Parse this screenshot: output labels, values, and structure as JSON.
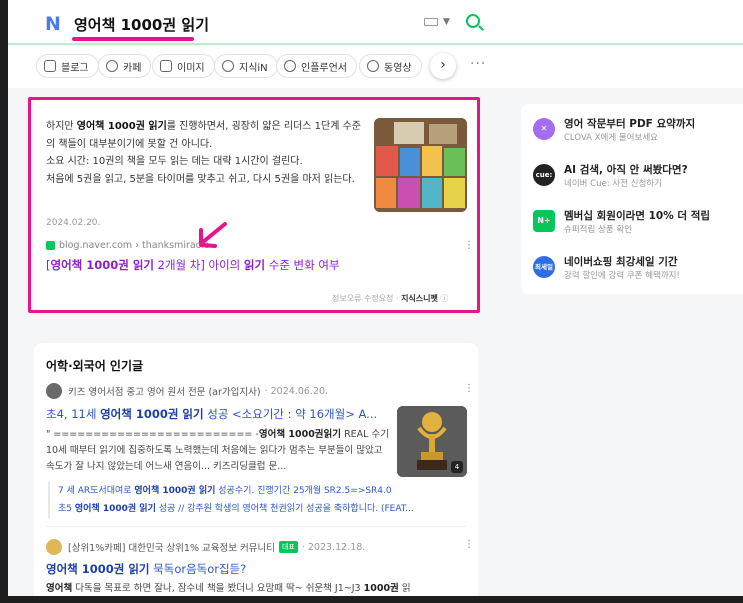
{
  "header": {
    "logo": "N",
    "query": "영어책 1000권 읽기"
  },
  "tabs": [
    {
      "label": "블로그",
      "icon": "blog-icon"
    },
    {
      "label": "카페",
      "icon": "cafe-icon"
    },
    {
      "label": "이미지",
      "icon": "image-icon"
    },
    {
      "label": "지식iN",
      "icon": "kin-icon"
    },
    {
      "label": "인플루언서",
      "icon": "influencer-icon"
    },
    {
      "label": "동영상",
      "icon": "video-icon"
    }
  ],
  "snippet": {
    "pre": "하지만 ",
    "bold1": "영어책 1000권 읽기",
    "post": "를 진행하면서, 굉장히 얇은 리더스 1단계 수준의 책들이 대부분이기에 못할 건 아니다.",
    "line2": "소요 시간: 10권의 책을 모두 읽는 데는 대략 1시간이 걸린다.",
    "line3": "처음에 5권을 읽고, 5분을 타이머를 맞추고 쉬고, 다시 5권을 마저 읽는다.",
    "date": "2024.02.20.",
    "source": "blog.naver.com › thanksmiracle",
    "link_prefix": "[",
    "link_bold": "영어책 1000권 읽기",
    "link_mid": " 2개월 차] 아이의 ",
    "link_bold2": "읽기",
    "link_suffix": " 수준 변화 여부",
    "footer_report": "정보오류 수정요청 · ",
    "footer_brand": "지식스니펫"
  },
  "side": [
    {
      "title": "영어 작문부터 PDF 요약까지",
      "sub": "CLOVA X에게 물어보세요",
      "icon": "clova-x-icon",
      "color": "#a66cf0",
      "mark": "✕"
    },
    {
      "title": "AI 검색, 아직 안 써봤다면?",
      "sub": "네이버 Cue: 사전 신청하기",
      "icon": "cue-icon",
      "color": "#222222",
      "mark": "cue:"
    },
    {
      "title": "멤버십 회원이라면 10% 더 적립",
      "sub": "슈퍼적립 상품 확인",
      "icon": "npay-icon",
      "color": "#03c75a",
      "mark": "N+"
    },
    {
      "title": "네이버쇼핑 최강세일 기간",
      "sub": "강력 할인에 강력 쿠폰 혜택까지!",
      "icon": "shopping-icon",
      "color": "#2f6de8",
      "mark": "최세일"
    }
  ],
  "popular": {
    "heading": "어학·외국어 인기글",
    "post1": {
      "author": "키즈 영어서점 중고 영어 원서 전문 (ar가입지사)",
      "date": "· 2024.06.20.",
      "title_pre": "초4, 11세 ",
      "title_bold": "영어책 1000권 읽기",
      "title_post": " 성공 <소요기간 : 약 16개월> A...",
      "body_pre": "\" ========================= -",
      "body_bold": "영어책 1000권읽기",
      "body_post": " REAL 수기 10세 때부터 읽기에 집중하도록 노력했는데 처음에는 읽다가 멈추는 부분들이 많았고 속도가 잘 나지 않았는데 어느새 연음이... 키즈리딩클럽 문...",
      "image_count": "4",
      "sub1_pre": "7 세 AR도서대여로 ",
      "sub1_bold": "영어책 1000권 읽기",
      "sub1_post": " 성공수기. 진행기간 25개월 SR2.5=>SR4.0",
      "sub2_pre": "초5 ",
      "sub2_bold": "영어책 1000권 읽기",
      "sub2_post": " 성공 // 강주원 학생의 영어책 천권읽기 성공을 축하합니다. (FEAT..."
    },
    "post2": {
      "author": "[상위1%카페] 대한민국 상위1% 교육정보 커뮤니티",
      "badge": "대표",
      "date": "· 2023.12.18.",
      "title_bold": "영어책 1000권 읽기",
      "title_post": " 묵독or음독or집듣?",
      "body_bold1": "영어책",
      "body_mid": " 다독을 목표로 하면 잘나, 잠수네 책을 봤더니 요맘때 딱~ 쉬운책 J1~J3 ",
      "body_bold2": "1000권",
      "body_post": " 읽"
    }
  }
}
